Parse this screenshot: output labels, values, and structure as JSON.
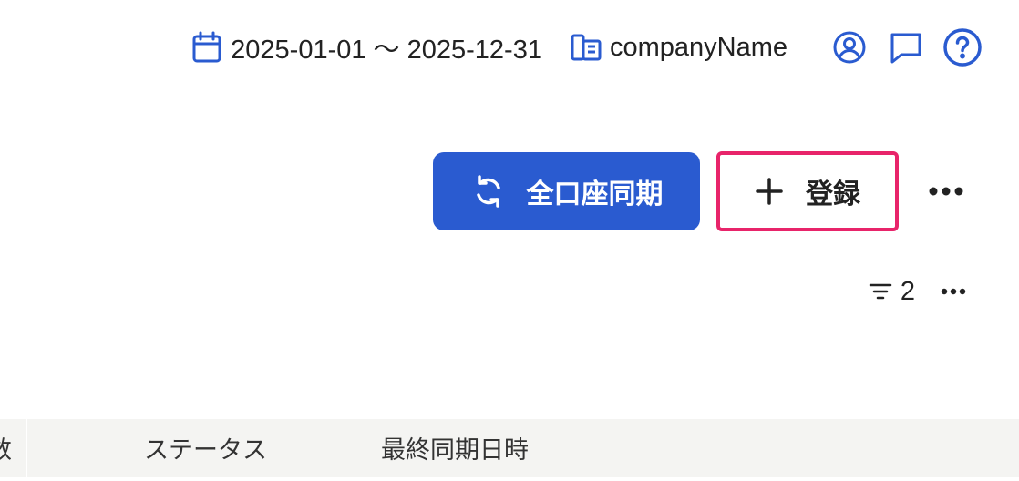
{
  "header": {
    "date_range": "2025-01-01 〜 2025-12-31",
    "company_name": "companyName",
    "icons": {
      "calendar": "calendar-icon",
      "company": "building-icon",
      "account": "user-circle-icon",
      "feedback": "chat-icon",
      "help": "help-icon"
    }
  },
  "actions": {
    "sync_all_label": "全口座同期",
    "register_label": "登録"
  },
  "filter": {
    "count": "2"
  },
  "table": {
    "columns": [
      "数",
      "ステータス",
      "最終同期日時"
    ]
  },
  "colors": {
    "accent": "#2a5bd0",
    "highlight_border": "#e8246a",
    "header_bg": "#f4f4f2"
  }
}
